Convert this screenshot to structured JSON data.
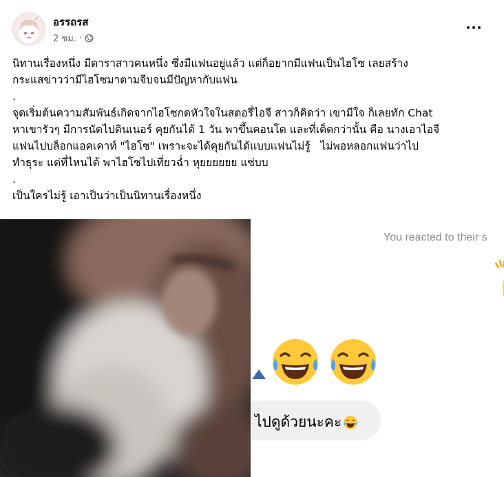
{
  "post": {
    "author": "อรรถรส",
    "time": "2 ชม.",
    "separator": "·",
    "privacy_icon": "globe-icon",
    "menu_icon": "more-options-icon",
    "paragraphs": [
      "นิทานเรื่องหนึ่ง มีดาราสาวคนหนึ่ง ซึ่งมีแฟนอยู่แล้ว แต่ก็อยากมีแฟนเป็นไฮโซ เลยสร้าง\nกระแสข่าวว่ามีไฮโซมาตามจีบจนมีปัญหากับแฟน",
      ".",
      "จุดเริ่มต้นความสัมพันธ์เกิดจากไฮโซกดหัวใจในสตอรี่ไอจี สาวก็คิดว่า เขามีใจ ก็เลยทัก Chat\nหาเขารัวๆ มีการนัดไปดินเนอร์ คุยกันได้ 1 วัน พาขึ้นคอนโด และที่เด็ดกว่านั้น คือ นางเอาไอจี\nแฟนไปบล็อกแอคเคาท์ \"ไฮโซ\" เพราะจะได้คุยกันได้แบบแฟนไม่รู้   ไม่พอหลอกแฟนว่าไป\nทำธุระ แต่ที่ไหนได้ พาไฮโซไปเที่ยวฉ่ำ หุยยยยยย แซ่บบ",
      ".",
      "เป็นใครไม่รู้ เอาเป็นว่าเป็นนิทานเรื่องหนึ่ง"
    ]
  },
  "chat_screenshot": {
    "reacted_text": "You reacted to their s",
    "message_text": "ไปดูด้วยนะคะ",
    "reaction_icon": "clapping-hands-icon",
    "emoji_icon": "tears-of-joy-emoji-icon"
  },
  "colors": {
    "text": "#050505",
    "meta": "#65676b",
    "bubble": "#f0f0f0",
    "emoji_yellow": "#f7b500"
  }
}
